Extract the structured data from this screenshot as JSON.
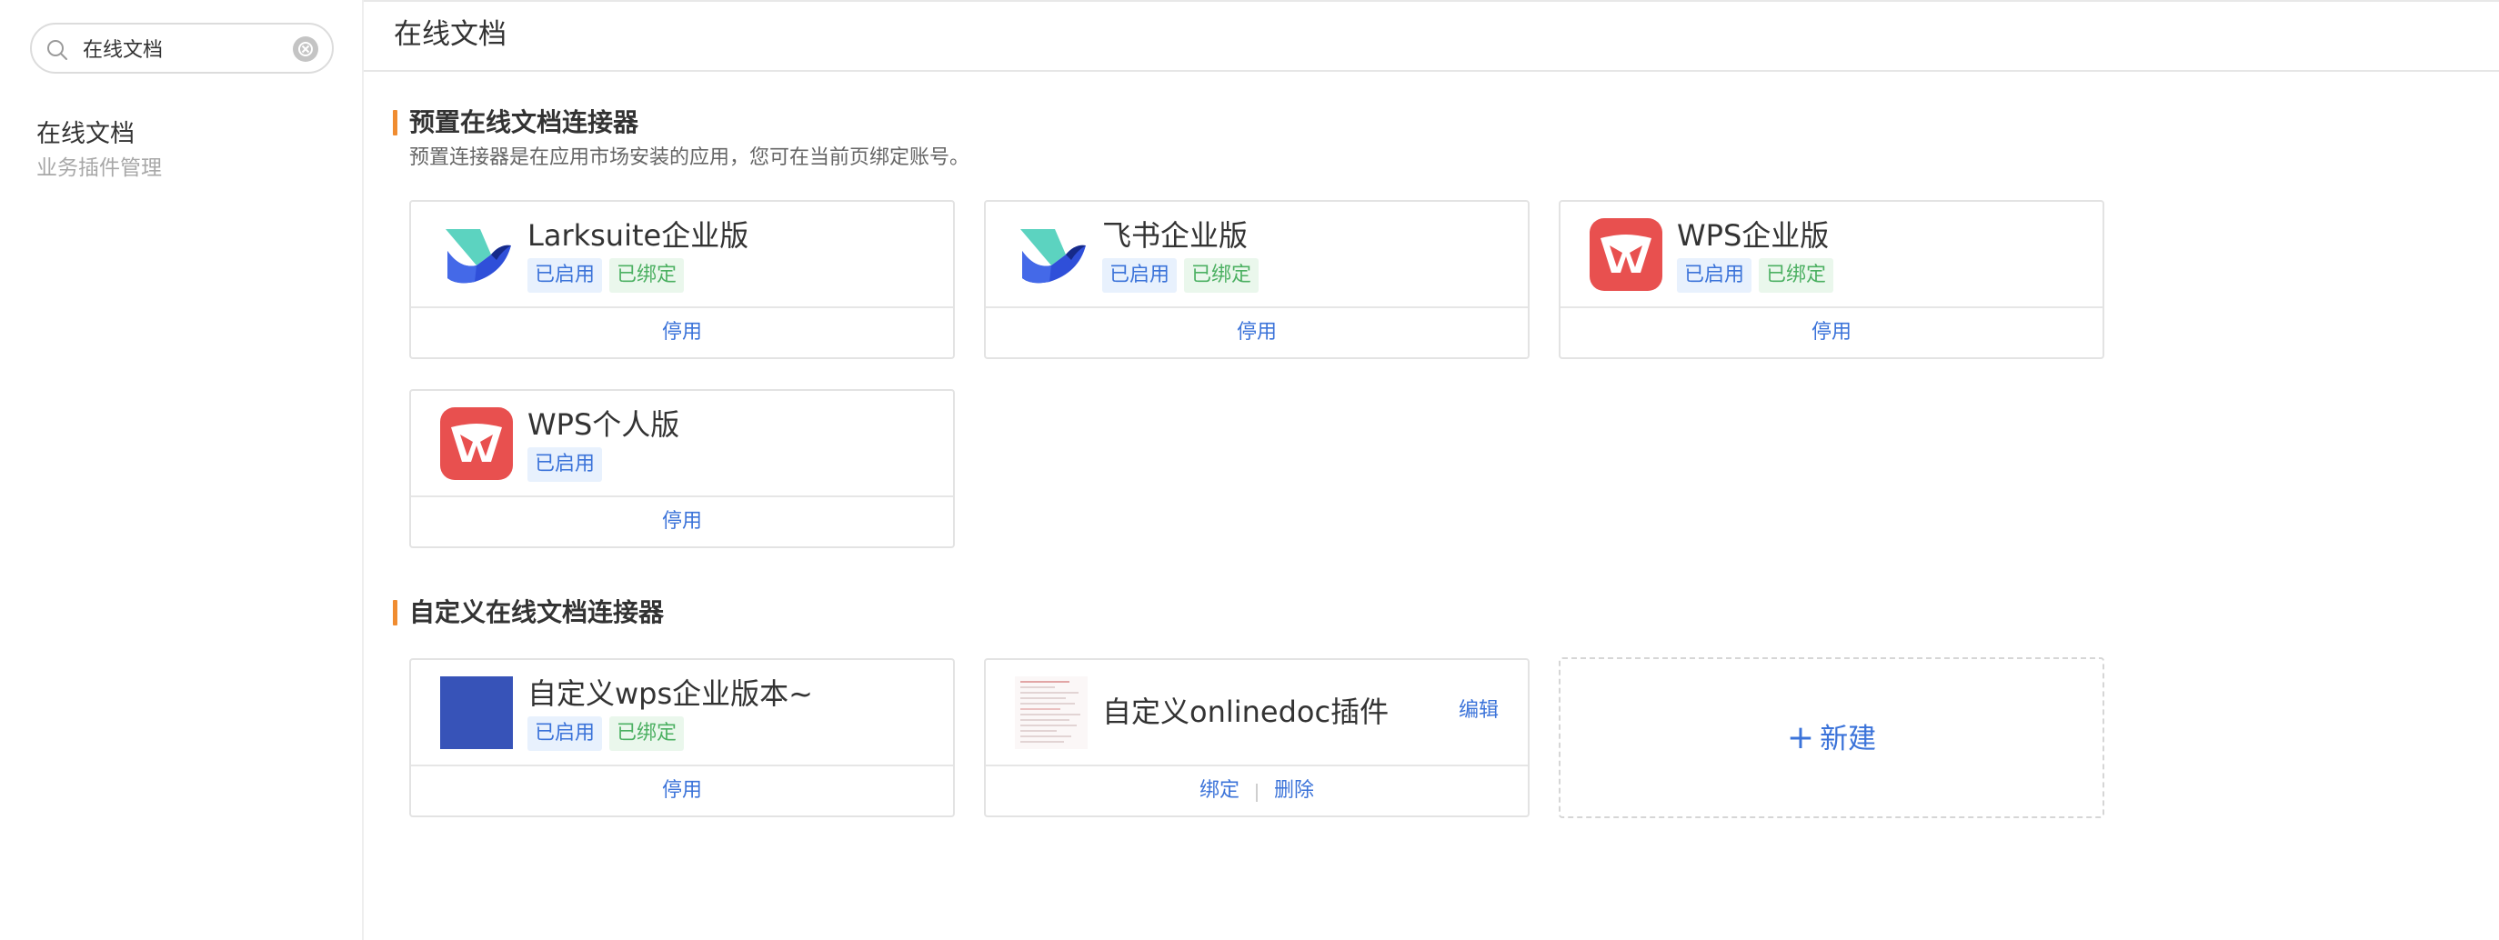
{
  "search": {
    "value": "在线文档",
    "placeholder": ""
  },
  "sidebar": {
    "items": [
      {
        "title": "在线文档",
        "subtitle": "业务插件管理"
      }
    ]
  },
  "page": {
    "title": "在线文档"
  },
  "preset_section": {
    "title": "预置在线文档连接器",
    "description": "预置连接器是在应用市场安装的应用，您可在当前页绑定账号。",
    "cards": [
      {
        "name": "Larksuite企业版",
        "tag_enabled": "已启用",
        "tag_bound": "已绑定",
        "action": "停用",
        "logo": "lark-bird-icon"
      },
      {
        "name": "飞书企业版",
        "tag_enabled": "已启用",
        "tag_bound": "已绑定",
        "action": "停用",
        "logo": "lark-bird-icon"
      },
      {
        "name": "WPS企业版",
        "tag_enabled": "已启用",
        "tag_bound": "已绑定",
        "action": "停用",
        "logo": "wps-icon"
      },
      {
        "name": "WPS个人版",
        "tag_enabled": "已启用",
        "action": "停用",
        "logo": "wps-icon"
      }
    ]
  },
  "custom_section": {
    "title": "自定义在线文档连接器",
    "cards": [
      {
        "name": "自定义wps企业版本~",
        "tag_enabled": "已启用",
        "tag_bound": "已绑定",
        "action": "停用",
        "logo": "blue-square-thumbnail"
      },
      {
        "name": "自定义onlinedoc插件",
        "edit": "编辑",
        "bind": "绑定",
        "delete": "删除",
        "logo": "document-thumbnail"
      }
    ],
    "new_label": "新建"
  },
  "colors": {
    "accent": "#3b73d9",
    "section_bar": "#f08c30",
    "tag_enabled_bg": "#e8f1fd",
    "tag_bound_text": "#4cb062",
    "wps_red": "#e8504f",
    "custom_blue": "#3753b8"
  }
}
